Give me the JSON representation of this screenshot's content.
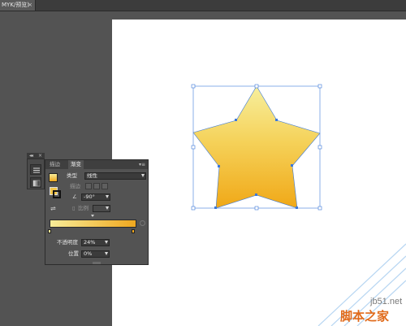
{
  "tabbar": {
    "doc_tab": "MYK/预览)",
    "close": "×"
  },
  "gradient_panel": {
    "tab_stroke": "描边",
    "tab_gradient": "渐变",
    "menu_icon": "menu-icon",
    "type_label": "类型",
    "type_value": "线性",
    "stroke_label": "描边",
    "angle_value": "-90°",
    "aspect_label": "比例",
    "opacity_label": "不透明度",
    "opacity_value": "24%",
    "location_label": "位置",
    "location_value": "0%",
    "gradient_start_color": "#f7ec98",
    "gradient_end_color": "#f0a81f"
  },
  "star": {
    "fill_top": "#f7ef9e",
    "fill_bottom": "#f0a817",
    "selection_color": "#3c78d8"
  },
  "watermark": {
    "domain": "jb51.net",
    "site": "脚本之家"
  }
}
